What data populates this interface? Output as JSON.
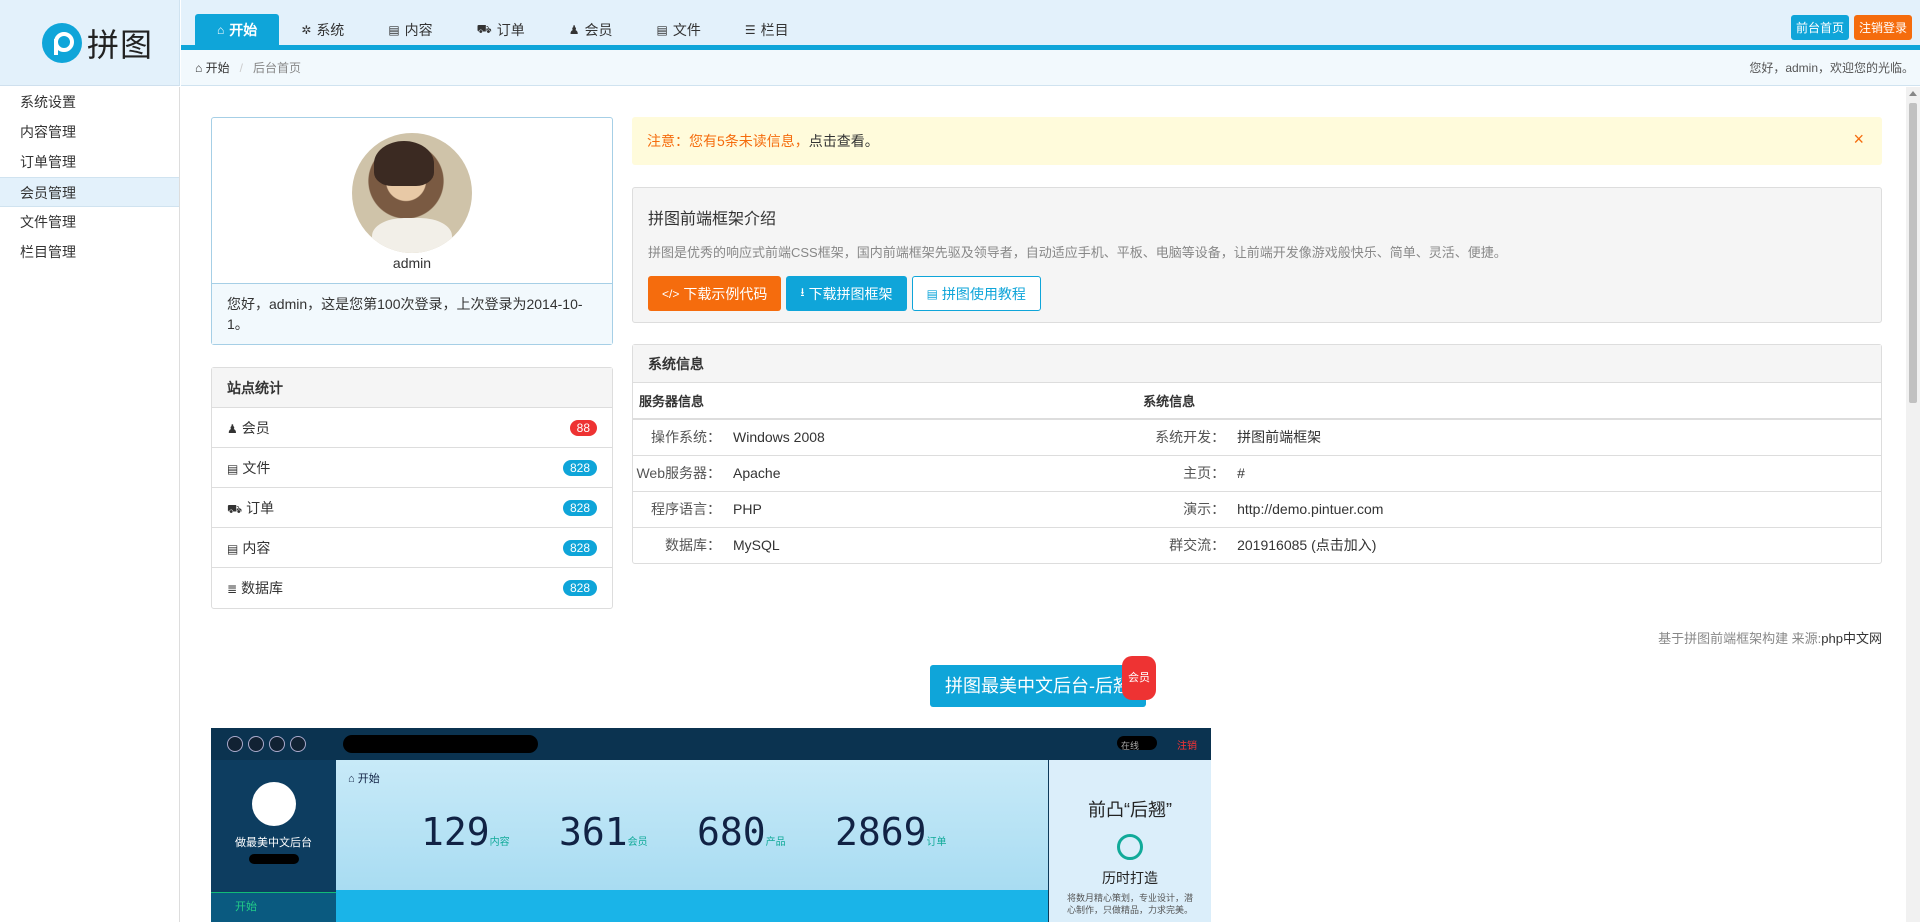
{
  "logo": {
    "text": "拼图"
  },
  "nav": [
    {
      "label": "开始",
      "icon": "home-icon",
      "glyph": "⌂",
      "active": true
    },
    {
      "label": "系统",
      "icon": "cog-icon",
      "glyph": "✲"
    },
    {
      "label": "内容",
      "icon": "file-icon",
      "glyph": "▤"
    },
    {
      "label": "订单",
      "icon": "cart-icon",
      "glyph": "⛟"
    },
    {
      "label": "会员",
      "icon": "user-icon",
      "glyph": "♟"
    },
    {
      "label": "文件",
      "icon": "file-icon",
      "glyph": "▤"
    },
    {
      "label": "栏目",
      "icon": "list-icon",
      "glyph": "☰"
    }
  ],
  "top_buttons": {
    "front": "前台首页",
    "logout": "注销登录"
  },
  "breadcrumb": {
    "home": "开始",
    "current": "后台首页"
  },
  "welcome": "您好，admin，欢迎您的光临。",
  "sidebar": [
    "系统设置",
    "内容管理",
    "订单管理",
    "会员管理",
    "文件管理",
    "栏目管理"
  ],
  "user": {
    "name": "admin",
    "message": "您好，admin，这是您第100次登录，上次登录为2014-10-1。"
  },
  "stats": {
    "title": "站点统计",
    "rows": [
      {
        "label": "会员",
        "icon": "user-icon",
        "glyph": "♟",
        "count": "88",
        "color": "#ee3333"
      },
      {
        "label": "文件",
        "icon": "file-icon",
        "glyph": "▤",
        "count": "828",
        "color": "#0fa5d9"
      },
      {
        "label": "订单",
        "icon": "cart-icon",
        "glyph": "⛟",
        "count": "828",
        "color": "#0fa5d9"
      },
      {
        "label": "内容",
        "icon": "file-icon",
        "glyph": "▤",
        "count": "828",
        "color": "#0fa5d9"
      },
      {
        "label": "数据库",
        "icon": "database-icon",
        "glyph": "≣",
        "count": "828",
        "color": "#0fa5d9"
      }
    ]
  },
  "notice": {
    "warn": "注意：您有5条未读信息，",
    "link": "点击查看。",
    "close": "×"
  },
  "intro": {
    "title": "拼图前端框架介绍",
    "desc": "拼图是优秀的响应式前端CSS框架，国内前端框架先驱及领导者，自动适应手机、平板、电脑等设备，让前端开发像游戏般快乐、简单、灵活、便捷。",
    "btn_demo": "下载示例代码",
    "btn_download": "下载拼图框架",
    "btn_tutorial": "拼图使用教程"
  },
  "sysinfo": {
    "title": "系统信息",
    "col1": "服务器信息",
    "col2": "系统信息",
    "rows": [
      {
        "k1": "操作系统：",
        "v1": "Windows 2008",
        "k2": "系统开发：",
        "v2": "拼图前端框架"
      },
      {
        "k1": "Web服务器：",
        "v1": "Apache",
        "k2": "主页：",
        "v2": "#"
      },
      {
        "k1": "程序语言：",
        "v1": "PHP",
        "k2": "演示：",
        "v2": "http://demo.pintuer.com"
      },
      {
        "k1": "数据库：",
        "v1": "MySQL",
        "k2": "群交流：",
        "v2": "201916085 (点击加入)"
      }
    ]
  },
  "footer": {
    "prefix": "基于拼图前端框架构建 来源:",
    "brand": "php中文网"
  },
  "promo": {
    "label": "拼图最美中文后台-后翘",
    "badge": "会员"
  },
  "preview": {
    "start": "开始",
    "caption": "做最美中文后台",
    "stats": [
      "129",
      "361",
      "680",
      "2869"
    ],
    "stat_labels": [
      "内容",
      "会员",
      "产品",
      "订单"
    ],
    "online": "在线",
    "logout": "注销",
    "nav_start": "开始",
    "right_title": "前凸“后翘”",
    "right_sub": "历时打造",
    "right_desc": "将数月精心策划，专业设计，潜心制作，只做精品，力求完美。"
  },
  "colors": {
    "accent": "#0fa5d9",
    "orange": "#f56c0d",
    "red": "#ee3333"
  }
}
